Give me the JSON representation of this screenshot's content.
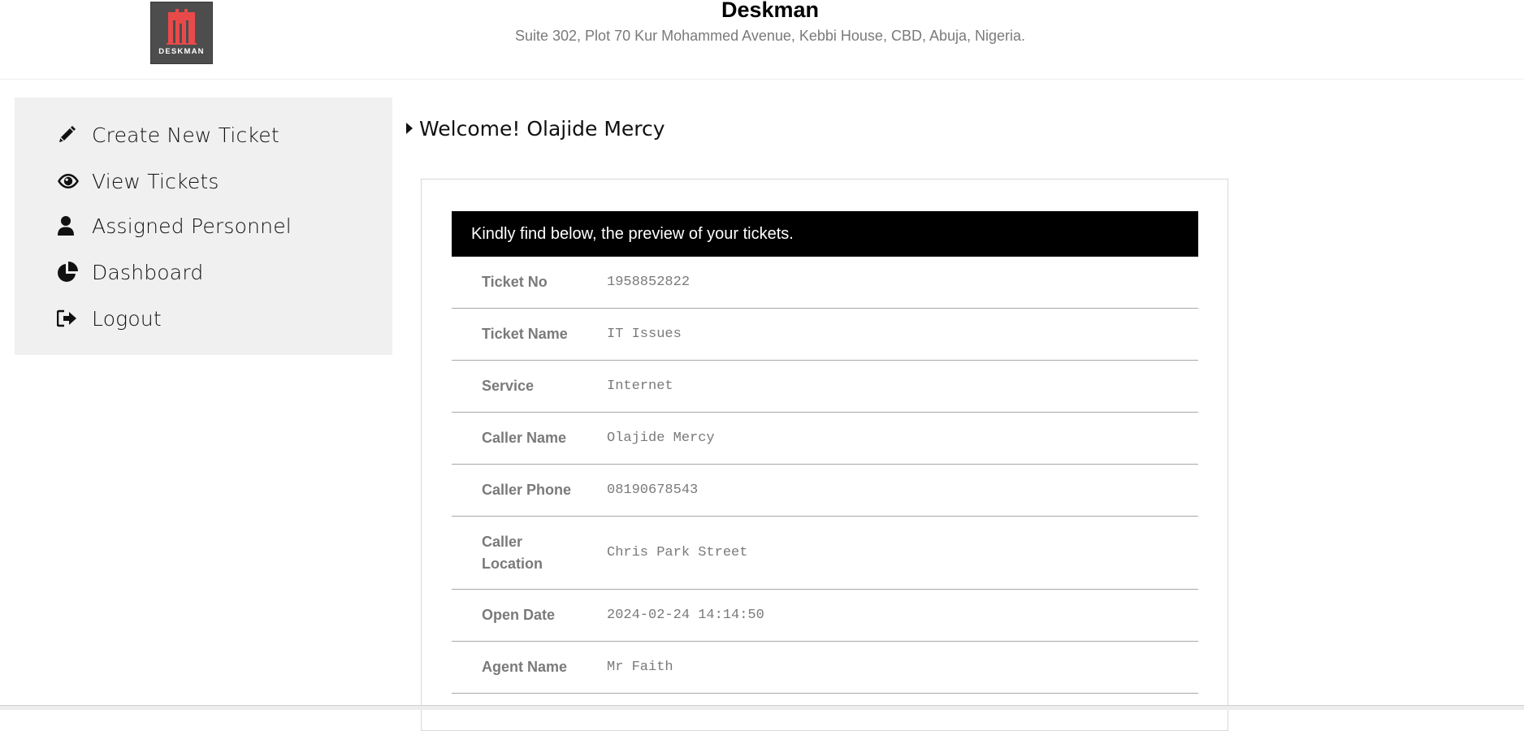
{
  "header": {
    "logo_text": "DESKMAN",
    "company_name": "Deskman",
    "address": "Suite 302, Plot 70 Kur Mohammed Avenue, Kebbi House, CBD, Abuja, Nigeria."
  },
  "sidebar": {
    "items": [
      {
        "label": "Create New Ticket",
        "icon": "pencil-icon"
      },
      {
        "label": "View Tickets",
        "icon": "eye-icon"
      },
      {
        "label": "Assigned Personnel",
        "icon": "user-icon"
      },
      {
        "label": "Dashboard",
        "icon": "pie-chart-icon"
      },
      {
        "label": "Logout",
        "icon": "sign-out-icon"
      }
    ]
  },
  "welcome": {
    "text": "Welcome! Olajide Mercy"
  },
  "ticket": {
    "banner": "Kindly find below, the preview of your tickets.",
    "rows": [
      {
        "key": "Ticket No",
        "value": "1958852822"
      },
      {
        "key": "Ticket Name",
        "value": "IT Issues"
      },
      {
        "key": "Service",
        "value": "Internet"
      },
      {
        "key": "Caller Name",
        "value": "Olajide Mercy"
      },
      {
        "key": "Caller Phone",
        "value": "08190678543"
      },
      {
        "key": "Caller Location",
        "value": "Chris Park Street"
      },
      {
        "key": "Open Date",
        "value": "2024-02-24 14:14:50"
      },
      {
        "key": "Agent Name",
        "value": "Mr Faith"
      }
    ]
  },
  "colors": {
    "brand_red": "#e84a4a",
    "banner_bg": "#000000",
    "sidebar_bg": "#f0f0f0",
    "muted_text": "#7a7a7a"
  }
}
